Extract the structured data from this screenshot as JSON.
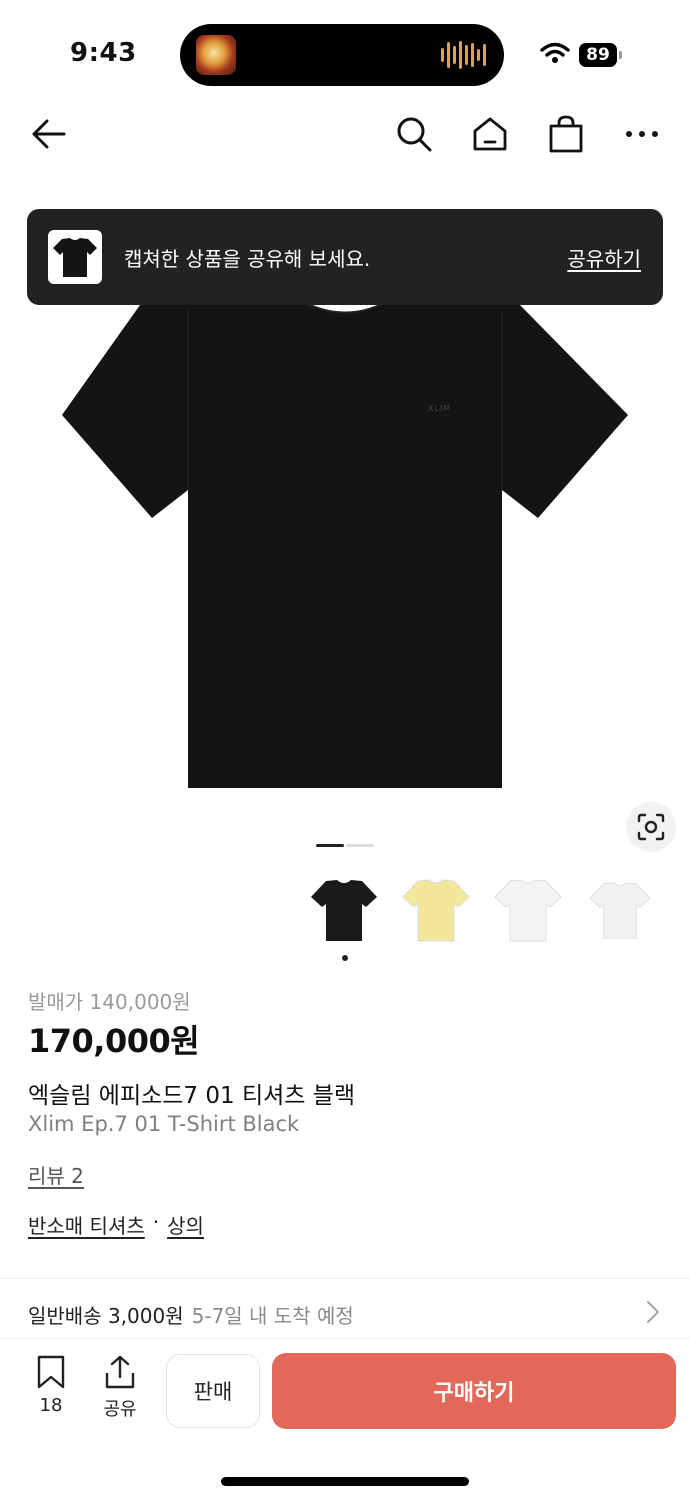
{
  "status_bar": {
    "time": "9:43",
    "battery": "89"
  },
  "nav": {
    "back_icon": "arrow-left-icon",
    "search_icon": "search-icon",
    "home_icon": "home-icon",
    "cart_icon": "shopping-bag-icon",
    "more_icon": "more-dots-icon"
  },
  "toast": {
    "message": "캡쳐한 상품을 공유해 보세요.",
    "action": "공유하기"
  },
  "product_image": {
    "brand_mark": "XLIM",
    "pager_active": 1,
    "pager_count": 2
  },
  "thumbnails": [
    {
      "color": "#1a1a1a",
      "name": "black"
    },
    {
      "color": "#f3e89a",
      "name": "yellow"
    },
    {
      "color": "#f4f4f4",
      "name": "white"
    },
    {
      "color": "#f2f2f0",
      "name": "ivory"
    }
  ],
  "product": {
    "original_price": "발매가 140,000원",
    "price": "170,000원",
    "name_ko": "엑슬림 에피소드7 01 티셔츠 블랙",
    "name_en": "Xlim Ep.7 01 T-Shirt Black",
    "review": "리뷰 2",
    "category_1": "반소매 티셔츠",
    "category_sep": "·",
    "category_2": "상의"
  },
  "shipping": {
    "label": "일반배송 3,000원",
    "eta": "5-7일 내 도착 예정"
  },
  "bottom_bar": {
    "bookmark_count": "18",
    "share_label": "공유",
    "sell_label": "판매",
    "buy_label": "구매하기"
  },
  "colors": {
    "accent": "#e2685a",
    "toast_bg": "#222222"
  }
}
